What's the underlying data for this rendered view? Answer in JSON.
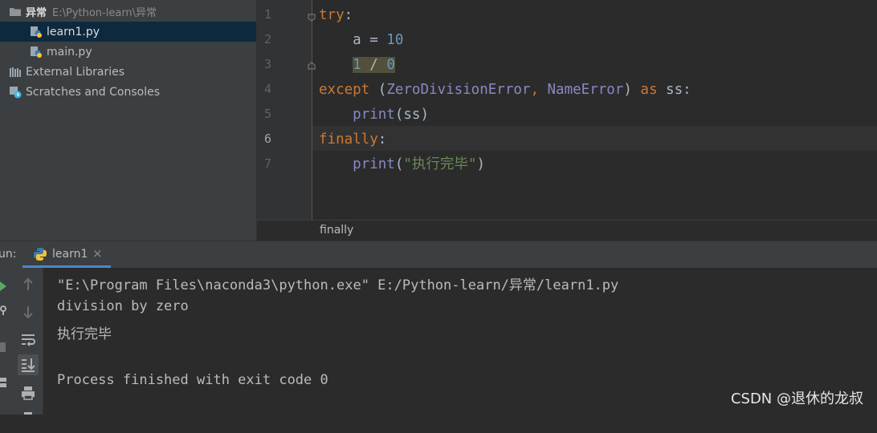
{
  "project": {
    "root": {
      "name": "异常",
      "path": "E:\\Python-learn\\异常"
    },
    "files": [
      {
        "name": "learn1.py",
        "selected": true
      },
      {
        "name": "main.py",
        "selected": false
      }
    ],
    "external_libraries": "External Libraries",
    "scratches": "Scratches and Consoles"
  },
  "editor": {
    "line_numbers": [
      "1",
      "2",
      "3",
      "4",
      "5",
      "6",
      "7"
    ],
    "current_line": 6,
    "lines": [
      [
        {
          "t": "try",
          "c": "kw"
        },
        {
          "t": ":",
          "c": ""
        }
      ],
      [
        {
          "t": "    a = ",
          "c": ""
        },
        {
          "t": "10",
          "c": "num"
        }
      ],
      [
        {
          "t": "    ",
          "c": ""
        },
        {
          "t": "1",
          "c": "num hl"
        },
        {
          "t": " / ",
          "c": "hl"
        },
        {
          "t": "0",
          "c": "num hl"
        }
      ],
      [
        {
          "t": "except ",
          "c": "kw"
        },
        {
          "t": "(",
          "c": ""
        },
        {
          "t": "ZeroDivisionError",
          "c": "builtin"
        },
        {
          "t": ", ",
          "c": "kw"
        },
        {
          "t": "NameError",
          "c": "builtin"
        },
        {
          "t": ") ",
          "c": ""
        },
        {
          "t": "as ",
          "c": "kw"
        },
        {
          "t": "ss:",
          "c": ""
        }
      ],
      [
        {
          "t": "    ",
          "c": ""
        },
        {
          "t": "print",
          "c": "builtin"
        },
        {
          "t": "(ss)",
          "c": ""
        }
      ],
      [
        {
          "t": "finally",
          "c": "kw"
        },
        {
          "t": ":",
          "c": ""
        }
      ],
      [
        {
          "t": "    ",
          "c": ""
        },
        {
          "t": "print",
          "c": "builtin"
        },
        {
          "t": "(",
          "c": ""
        },
        {
          "t": "\"执行完毕\"",
          "c": "str"
        },
        {
          "t": ")",
          "c": ""
        }
      ]
    ],
    "breadcrumb": "finally"
  },
  "run": {
    "label": "un:",
    "tab": "learn1",
    "tab_close": "×",
    "console_lines": [
      "\"E:\\Program Files\\naconda3\\python.exe\" E:/Python-learn/异常/learn1.py",
      "division by zero",
      "执行完毕",
      "",
      "Process finished with exit code 0"
    ]
  },
  "watermark": "CSDN @退休的龙叔",
  "colors": {
    "accent": "#4a88c7",
    "keyword": "#cc7832",
    "number": "#6897bb",
    "builtin": "#8888c6",
    "string": "#6a8759"
  }
}
